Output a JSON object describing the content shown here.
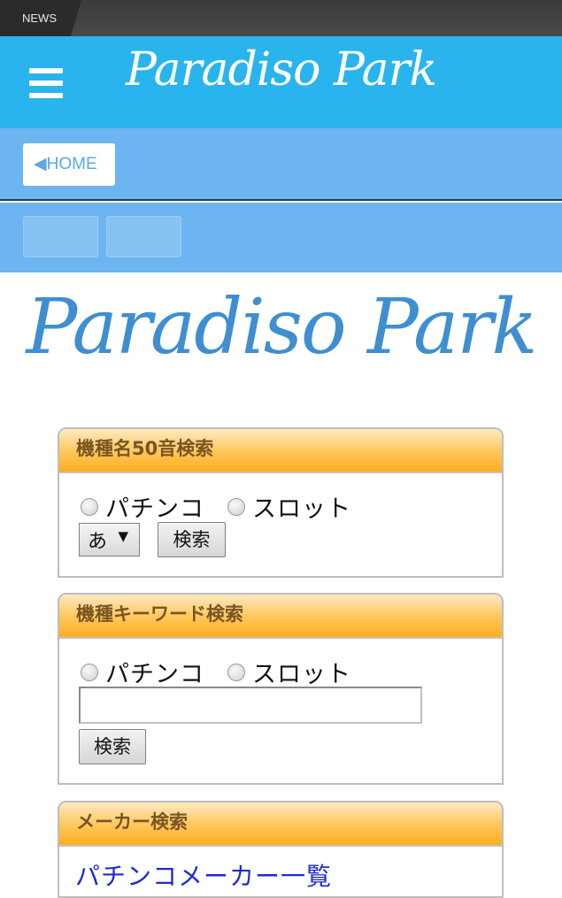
{
  "status_bar": {
    "news_label": "NEWS"
  },
  "header": {
    "logo_text": "Paradiso Park",
    "menu_icon": "hamburger-menu-icon"
  },
  "nav": {
    "home_label": "◀HOME"
  },
  "content": {
    "logo_text": "Paradiso Park"
  },
  "panel_50on": {
    "title": "機種名50音検索",
    "radio_pachinko": "パチンコ",
    "radio_slot": "スロット",
    "select_value": "あ",
    "search_label": "検索"
  },
  "panel_keyword": {
    "title": "機種キーワード検索",
    "radio_pachinko": "パチンコ",
    "radio_slot": "スロット",
    "input_value": "",
    "search_label": "検索"
  },
  "panel_maker": {
    "title": "メーカー検索",
    "link_pachinko": "パチンコメーカー一覧"
  },
  "colors": {
    "header": "#2ab4ee",
    "nav": "#6cb5f0",
    "panel_head": "#ffad1f",
    "link": "#1f2bd0"
  }
}
